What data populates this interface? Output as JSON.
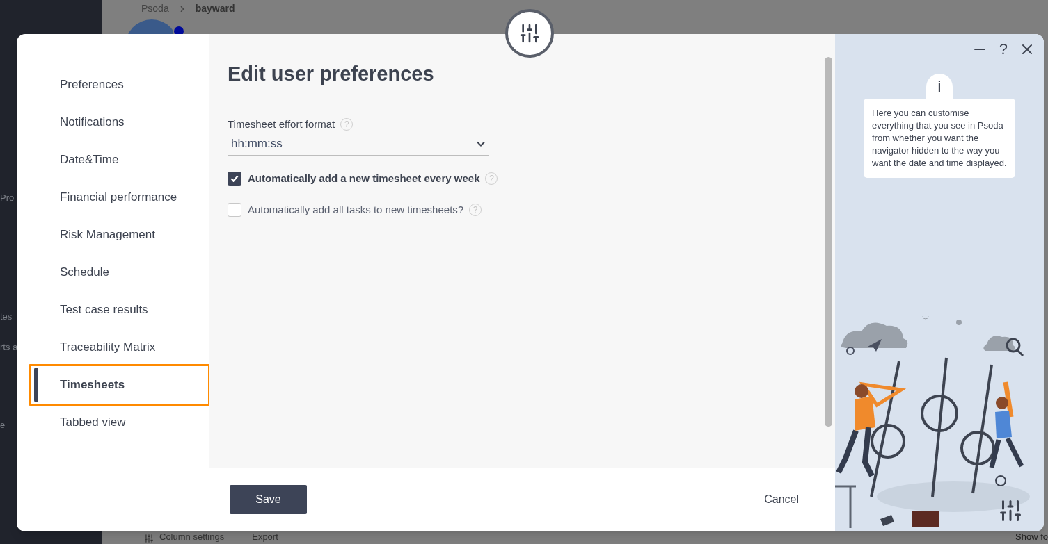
{
  "background": {
    "breadcrumb": [
      "Psoda",
      "bayward"
    ],
    "sidebar_items": [
      "Pro",
      "tes",
      "rts a",
      "e"
    ],
    "toolbar": [
      "Column settings",
      "Export"
    ],
    "toolbar_right": "Show fo"
  },
  "dialog": {
    "nav": [
      {
        "label": "Preferences",
        "selected": false
      },
      {
        "label": "Notifications",
        "selected": false
      },
      {
        "label": "Date&Time",
        "selected": false
      },
      {
        "label": "Financial performance",
        "selected": false
      },
      {
        "label": "Risk Management",
        "selected": false
      },
      {
        "label": "Schedule",
        "selected": false
      },
      {
        "label": "Test case results",
        "selected": false
      },
      {
        "label": "Traceability Matrix",
        "selected": false
      },
      {
        "label": "Timesheets",
        "selected": true
      },
      {
        "label": "Tabbed view",
        "selected": false
      }
    ],
    "title": "Edit user preferences",
    "fields": [
      {
        "kind": "select",
        "label": "Timesheet effort format",
        "value": "hh:mm:ss",
        "help_mark": "?"
      },
      {
        "kind": "checkbox",
        "label": "Automatically add a new timesheet every week",
        "checked": true,
        "help_mark": "?"
      },
      {
        "kind": "checkbox",
        "label": "Automatically add all tasks to new timesheets?",
        "checked": false,
        "help_mark": "?"
      }
    ],
    "save": "Save",
    "cancel": "Cancel",
    "help_button": "?",
    "info_mark": "i",
    "info_text": "Here you can customise everything that you see in Psoda from whether you want the navigator hidden to the way you want the date and time displayed."
  }
}
